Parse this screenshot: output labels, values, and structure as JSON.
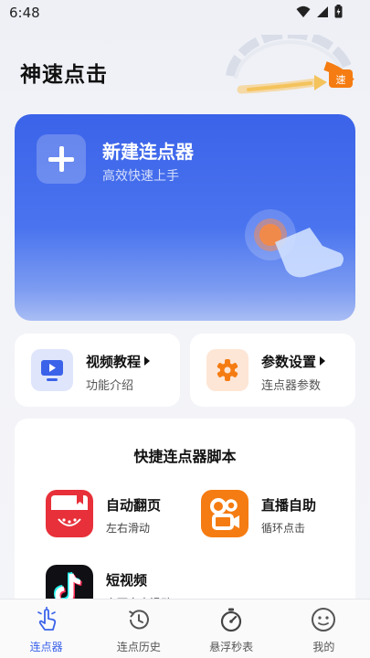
{
  "status": {
    "time": "6:48"
  },
  "header": {
    "title": "神速点击",
    "badge": "速"
  },
  "hero": {
    "title": "新建连点器",
    "subtitle": "高效快速上手"
  },
  "quick_cards": [
    {
      "title": "视频教程",
      "subtitle": "功能介绍",
      "icon": "video-tutorial-icon"
    },
    {
      "title": "参数设置",
      "subtitle": "连点器参数",
      "icon": "settings-icon"
    }
  ],
  "scripts": {
    "title": "快捷连点器脚本",
    "items": [
      {
        "title": "自动翻页",
        "subtitle": "左右滑动",
        "icon": "book-icon"
      },
      {
        "title": "直播自助",
        "subtitle": "循环点击",
        "icon": "kuaishou-icon"
      },
      {
        "title": "短视频",
        "subtitle": "上下自由滑动",
        "icon": "tiktok-icon"
      }
    ]
  },
  "nav": {
    "items": [
      {
        "label": "连点器",
        "icon": "tap-hand-icon",
        "active": true
      },
      {
        "label": "连点历史",
        "icon": "history-icon",
        "active": false
      },
      {
        "label": "悬浮秒表",
        "icon": "stopwatch-icon",
        "active": false
      },
      {
        "label": "我的",
        "icon": "profile-face-icon",
        "active": false
      }
    ]
  },
  "colors": {
    "accent": "#3b63e9",
    "orange": "#f57c12",
    "red": "#e8303a"
  }
}
